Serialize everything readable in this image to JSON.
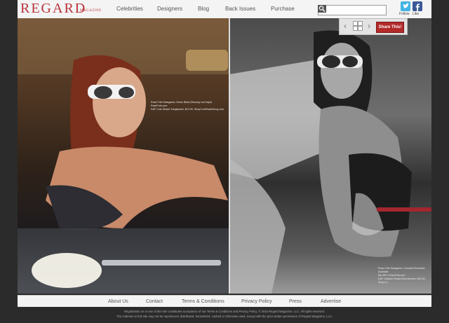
{
  "brand": {
    "name": "REGARD",
    "subtitle": "MAGAZINE"
  },
  "nav": [
    "Celebrities",
    "Designers",
    "Blog",
    "Back Issues",
    "Purchase"
  ],
  "search": {
    "placeholder": ""
  },
  "social": {
    "twitter": "Follow",
    "facebook": "Like"
  },
  "controls": {
    "share_label": "Share This!",
    "prev": "‹",
    "next": "›"
  },
  "captions": {
    "left": [
      "Rose Foth Swingame, Dress Bikini (Rumsey surf style)",
      "RoseFoth.com",
      "D&F Cote Shade Sunglasses, $19.99, ShopCoolShadeSung.com"
    ],
    "right": [
      "Rose Foth Swingame, Corseted Swimsuit, Available",
      "Bib.999 / RoseFoth.com",
      "D&F Outdoor Shade Brownbrown, $19.99, ShopCo..."
    ]
  },
  "footer": {
    "links": [
      "About Us",
      "Contact",
      "Terms & Conditions",
      "Privacy Policy",
      "Press",
      "Advertise"
    ],
    "legal_1": "Registration on or use of this site constitutes acceptance of our Terms & Conditions and Privacy Policy. © 2010 Regard Magazine, LLC. All rights reserved.",
    "legal_2": "The material on this site may not be reproduced, distributed, transmitted, cached or otherwise used, except with the prior written permission of Regard Magazine, LLC."
  },
  "colors": {
    "brand": "#b8343a",
    "share": "#b22a2a",
    "twitter": "#43b3e4",
    "facebook": "#3b5998"
  }
}
